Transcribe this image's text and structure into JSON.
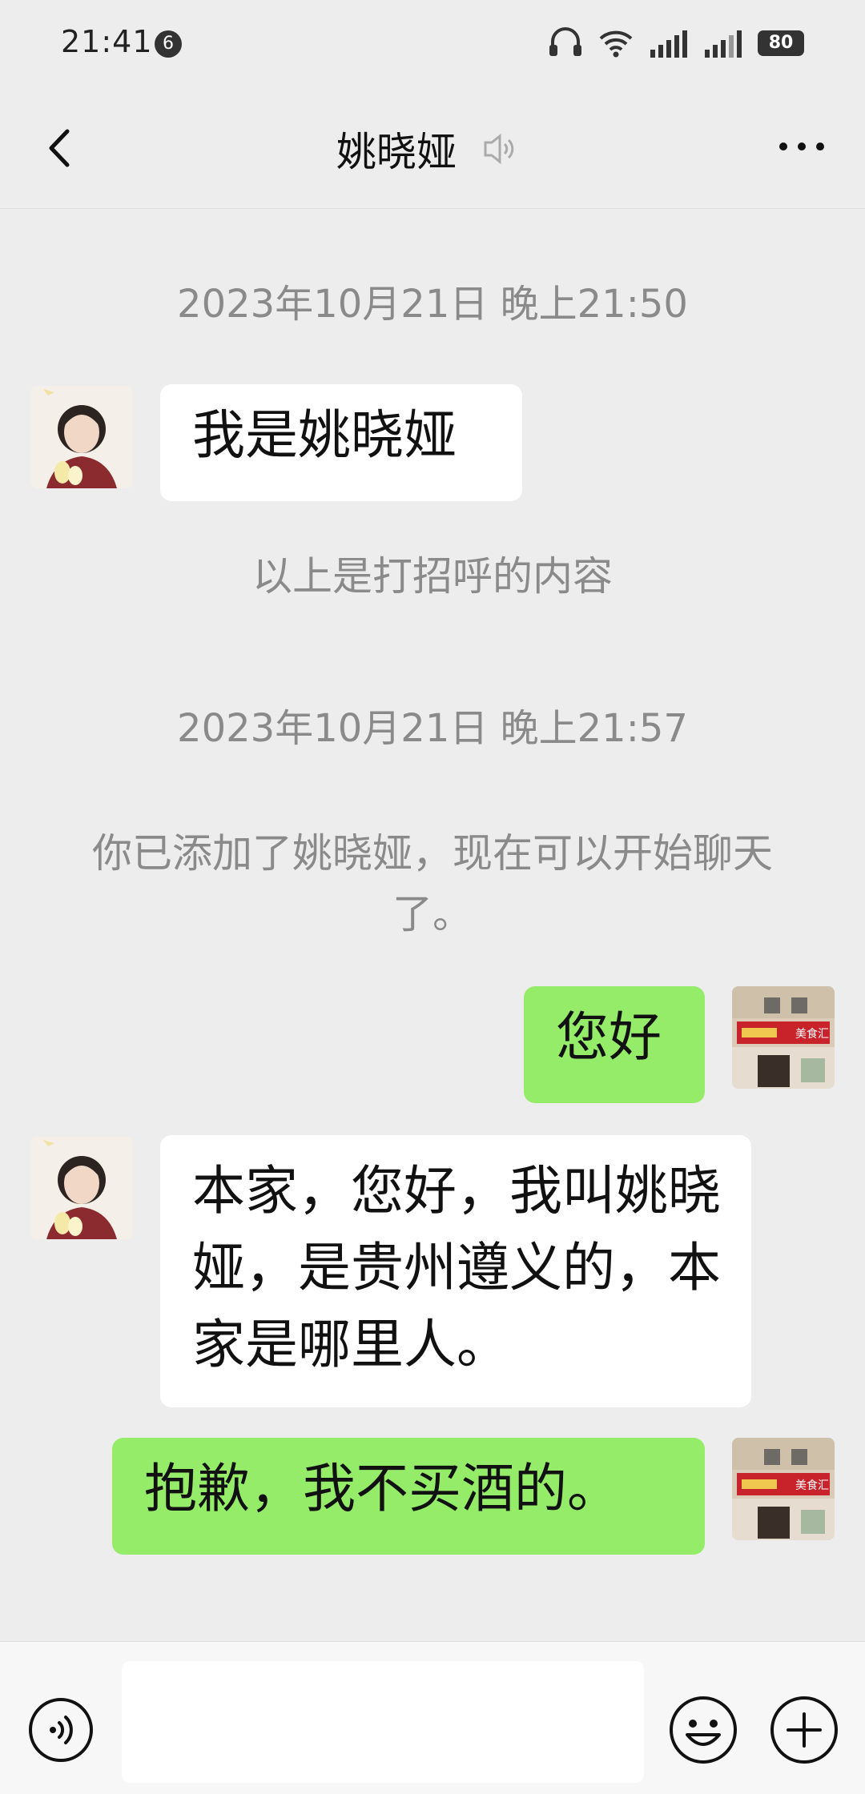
{
  "status_bar": {
    "time": "21:41",
    "notification_count": "6",
    "battery": "80"
  },
  "header": {
    "title": "姚晓娅"
  },
  "messages": {
    "timestamp_1": "2023年10月21日 晚上21:50",
    "in_1": "我是姚晓娅",
    "system_1": "以上是打招呼的内容",
    "timestamp_2": "2023年10月21日 晚上21:57",
    "system_2": "你已添加了姚晓娅，现在可以开始聊天了。",
    "out_1": "您好",
    "in_2": "本家，您好，我叫姚晓娅，是贵州遵义的，本家是哪里人。",
    "out_2": "抱歉，我不买酒的。"
  },
  "avatars": {
    "contact": "contact-avatar",
    "self_sign": "美食汇"
  },
  "input_bar": {
    "placeholder": ""
  },
  "colors": {
    "background": "#ededed",
    "outgoing_bubble": "#95ec69",
    "incoming_bubble": "#ffffff"
  }
}
